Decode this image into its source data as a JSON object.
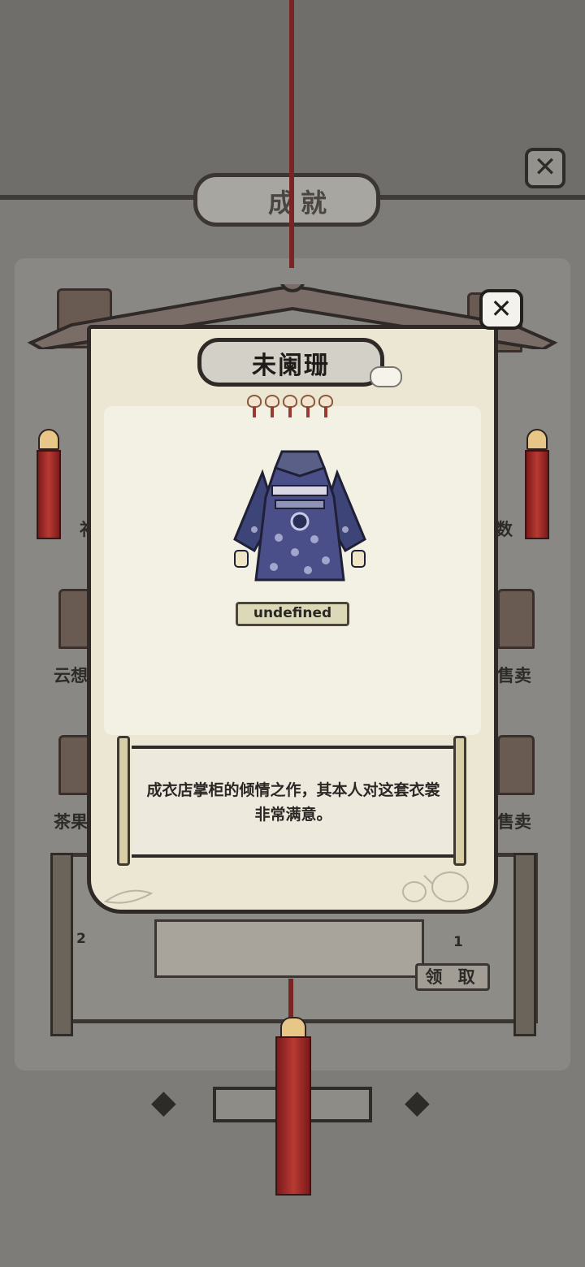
{
  "background": {
    "title": "成就",
    "labels_left": [
      "补",
      "云想",
      "茶果"
    ],
    "labels_right": [
      "数",
      "售卖",
      "售卖"
    ],
    "claim_label": "领 取",
    "counter_left": "2",
    "counter_right": "1"
  },
  "popup": {
    "item_name": "未阑珊",
    "star_count": 5,
    "tag_text": "undefined",
    "description": "成衣店掌柜的倾情之作，其本人对这套衣裳非常满意。",
    "close_icon": "close-x-icon"
  },
  "colors": {
    "card": "#ece7d3",
    "tassel_red": "#b83a32",
    "garment_purple": "#4a4f8a"
  }
}
